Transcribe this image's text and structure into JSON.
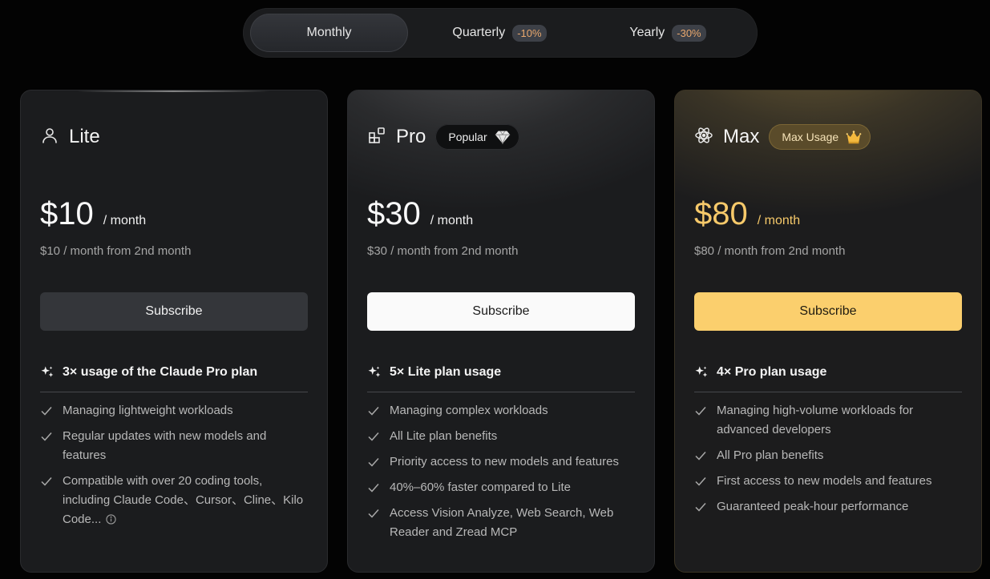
{
  "billing": {
    "options": [
      {
        "label": "Monthly",
        "discount": ""
      },
      {
        "label": "Quarterly",
        "discount": "-10%"
      },
      {
        "label": "Yearly",
        "discount": "-30%"
      }
    ],
    "selected": "Monthly"
  },
  "plans": [
    {
      "name": "Lite",
      "icon": "user-icon",
      "badge": "",
      "price": "$10",
      "period": "/ month",
      "note": "$10 / month from 2nd month",
      "button": "Subscribe",
      "highlight": "3× usage of the Claude Pro plan",
      "features": [
        "Managing lightweight workloads",
        "Regular updates with new models and features",
        "Compatible with over 20 coding tools, including Claude Code、Cursor、Cline、Kilo Code..."
      ]
    },
    {
      "name": "Pro",
      "icon": "apps-icon",
      "badge": "Popular",
      "badge_icon": "diamond-icon",
      "price": "$30",
      "period": "/ month",
      "note": "$30 / month from 2nd month",
      "button": "Subscribe",
      "highlight": "5× Lite plan usage",
      "features": [
        "Managing complex workloads",
        "All Lite plan benefits",
        "Priority access to new models and features",
        "40%–60% faster compared to Lite",
        "Access Vision Analyze, Web Search, Web Reader and Zread MCP"
      ]
    },
    {
      "name": "Max",
      "icon": "atom-icon",
      "badge": "Max Usage",
      "badge_icon": "crown-icon",
      "price": "$80",
      "period": "/ month",
      "note": "$80 / month from 2nd month",
      "button": "Subscribe",
      "highlight": "4× Pro plan usage",
      "features": [
        "Managing high-volume workloads for advanced developers",
        "All Pro plan benefits",
        "First access to new models and features",
        "Guaranteed peak-hour performance"
      ]
    }
  ],
  "colors": {
    "accent_gold": "#fbcf6d",
    "discount_text": "#e9a86e",
    "card_bg": "#1b1c1e"
  }
}
